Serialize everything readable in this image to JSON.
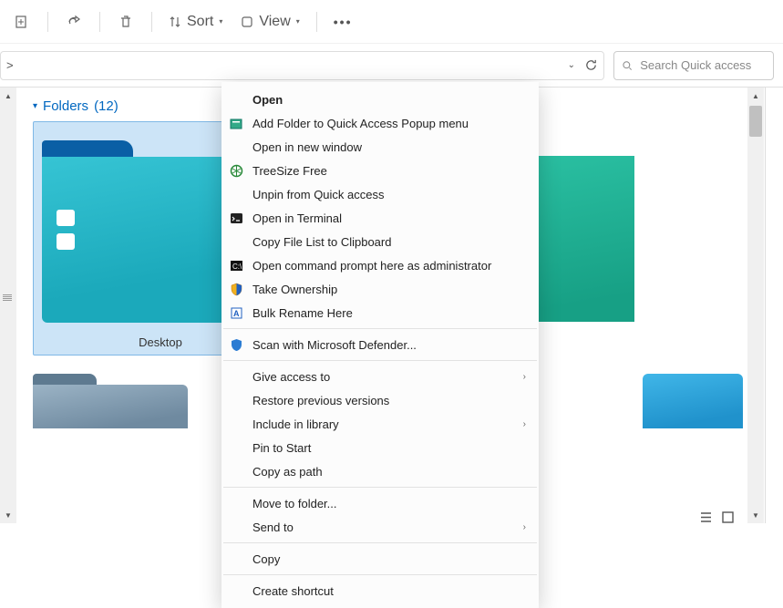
{
  "toolbar": {
    "sort_label": "Sort",
    "view_label": "View"
  },
  "addr": {
    "crumb": ">"
  },
  "search": {
    "placeholder": "Search Quick access"
  },
  "folders_header": {
    "label": "Folders",
    "count": "(12)"
  },
  "folder1_label": "Desktop",
  "context_menu": [
    {
      "label": "Open",
      "bold": true,
      "icon": ""
    },
    {
      "label": "Add Folder to Quick Access Popup menu",
      "icon": "popup"
    },
    {
      "label": "Open in new window",
      "icon": ""
    },
    {
      "label": "TreeSize Free",
      "icon": "treesize"
    },
    {
      "label": "Unpin from Quick access",
      "icon": ""
    },
    {
      "label": "Open in Terminal",
      "icon": "terminal"
    },
    {
      "label": "Copy File List to Clipboard",
      "icon": ""
    },
    {
      "label": "Open command prompt here as administrator",
      "icon": "cmd"
    },
    {
      "label": "Take Ownership",
      "icon": "shield"
    },
    {
      "label": "Bulk Rename Here",
      "icon": "rename"
    },
    {
      "sep": true
    },
    {
      "label": "Scan with Microsoft Defender...",
      "icon": "defender"
    },
    {
      "sep": true
    },
    {
      "label": "Give access to",
      "sub": true
    },
    {
      "label": "Restore previous versions"
    },
    {
      "label": "Include in library",
      "sub": true
    },
    {
      "label": "Pin to Start"
    },
    {
      "label": "Copy as path"
    },
    {
      "sep": true
    },
    {
      "label": "Move to folder..."
    },
    {
      "label": "Send to",
      "sub": true
    },
    {
      "sep": true
    },
    {
      "label": "Copy"
    },
    {
      "sep": true
    },
    {
      "label": "Create shortcut"
    }
  ]
}
